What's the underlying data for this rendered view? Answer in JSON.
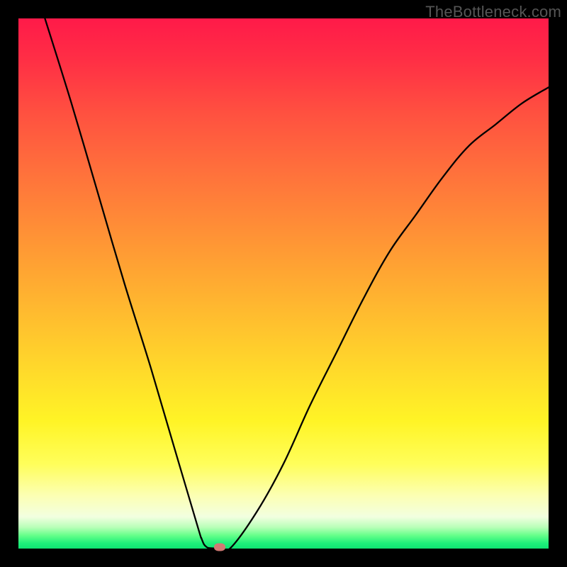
{
  "watermark": "TheBottleneck.com",
  "chart_data": {
    "type": "line",
    "title": "",
    "xlabel": "",
    "ylabel": "",
    "xlim": [
      0,
      1
    ],
    "ylim": [
      0,
      1
    ],
    "grid": false,
    "legend": false,
    "series": [
      {
        "name": "curve",
        "x": [
          0.05,
          0.1,
          0.15,
          0.2,
          0.25,
          0.3,
          0.34,
          0.345,
          0.35,
          0.355,
          0.36,
          0.38,
          0.4,
          0.45,
          0.5,
          0.55,
          0.6,
          0.65,
          0.7,
          0.75,
          0.8,
          0.85,
          0.9,
          0.95,
          1.0
        ],
        "y": [
          1.0,
          0.84,
          0.67,
          0.5,
          0.34,
          0.17,
          0.035,
          0.02,
          0.008,
          0.003,
          0.001,
          0.0,
          0.001,
          0.07,
          0.16,
          0.27,
          0.37,
          0.47,
          0.56,
          0.63,
          0.7,
          0.76,
          0.8,
          0.84,
          0.87
        ]
      }
    ],
    "marker": {
      "x": 0.38,
      "y": 0.003
    },
    "background_gradient": {
      "top": "#ff1a49",
      "mid": "#ffde2a",
      "bottom": "#0fe372"
    },
    "stroke_color": "#000000",
    "stroke_width": 2.3
  }
}
